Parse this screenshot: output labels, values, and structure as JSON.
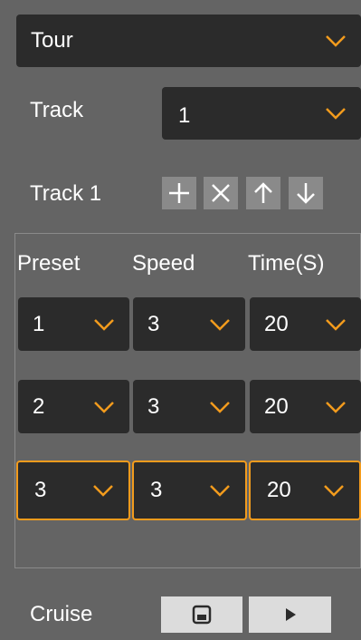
{
  "tour_select": {
    "value": "Tour"
  },
  "track_row": {
    "label": "Track",
    "value": "1"
  },
  "track_title": "Track 1",
  "track_actions": {
    "add": "plus-icon",
    "delete": "close-icon",
    "up": "arrow-up-icon",
    "down": "arrow-down-icon"
  },
  "table": {
    "headers": [
      "Preset",
      "Speed",
      "Time(S)"
    ],
    "rows": [
      {
        "preset": "1",
        "speed": "3",
        "time": "20",
        "selected": false
      },
      {
        "preset": "2",
        "speed": "3",
        "time": "20",
        "selected": false
      },
      {
        "preset": "3",
        "speed": "3",
        "time": "20",
        "selected": true
      }
    ]
  },
  "cruise": {
    "label": "Cruise",
    "save_icon": "save-icon",
    "play_icon": "play-icon"
  },
  "colors": {
    "panel_bg": "#646464",
    "control_bg": "#2b2b2b",
    "accent": "#f29b1d",
    "button_bg": "#8a8a8a"
  }
}
